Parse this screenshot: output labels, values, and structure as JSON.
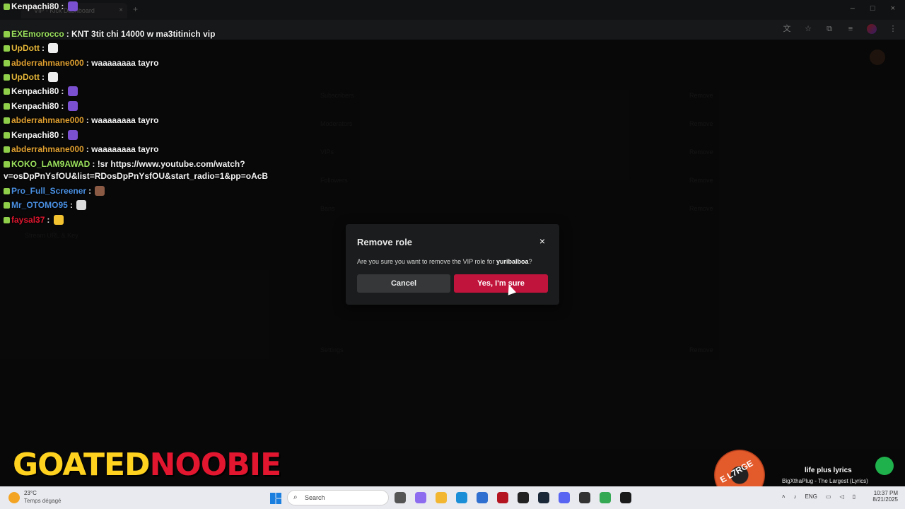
{
  "browser": {
    "tab_title": "VIP - Kick Dashboard",
    "tab_close": "×",
    "new_tab": "+",
    "controls": [
      "–",
      "□",
      "×"
    ]
  },
  "dashboard": {
    "items": [
      "Subscribers",
      "Moderators",
      "VIPs",
      "Followers",
      "Bans",
      "Settings"
    ],
    "side_item": "Stream URL & Key",
    "btn_label": "Remove"
  },
  "chat": [
    {
      "user": "Kenpachi80",
      "msg": "",
      "user_color": "#f2f2f2",
      "emote": "#7a4fd0"
    },
    {
      "user": "EXEmorocco",
      "msg": "KNT 3tit chi 14000 w ma3titinich vip",
      "user_color": "#9be15d",
      "emote": ""
    },
    {
      "user": "UpDott",
      "msg": "",
      "user_color": "#e8b93a",
      "emote": "#eeeeee"
    },
    {
      "user": "abderrahmane000",
      "msg": "waaaaaaaa tayro",
      "user_color": "#e0a030",
      "emote": ""
    },
    {
      "user": "UpDott",
      "msg": "",
      "user_color": "#e8b93a",
      "emote": "#eeeeee"
    },
    {
      "user": "Kenpachi80",
      "msg": "",
      "user_color": "#f2f2f2",
      "emote": "#7a4fd0"
    },
    {
      "user": "Kenpachi80",
      "msg": "",
      "user_color": "#f2f2f2",
      "emote": "#7a4fd0"
    },
    {
      "user": "abderrahmane000",
      "msg": "waaaaaaaa tayro",
      "user_color": "#e0a030",
      "emote": ""
    },
    {
      "user": "Kenpachi80",
      "msg": "",
      "user_color": "#f2f2f2",
      "emote": "#7a4fd0"
    },
    {
      "user": "abderrahmane000",
      "msg": "waaaaaaaa tayro",
      "user_color": "#e0a030",
      "emote": ""
    },
    {
      "user": "KOKO_LAM9AWAD",
      "msg": "!sr https://www.youtube.com/watch?",
      "user_color": "#9be15d",
      "emote": ""
    },
    {
      "user": "",
      "msg": "v=osDpPnYsfOU&list=RDosDpPnYsfOU&start_radio=1&pp=oAcB",
      "user_color": "#f2f2f2",
      "emote": ""
    },
    {
      "user": "Pro_Full_Screener",
      "msg": "",
      "user_color": "#4a90e2",
      "emote": "#8a5a44"
    },
    {
      "user": "Mr_OTOMO95",
      "msg": "",
      "user_color": "#4a90e2",
      "emote": "#dddddd"
    },
    {
      "user": "faysal37",
      "msg": "",
      "user_color": "#e2162f",
      "emote": "#f2c230"
    }
  ],
  "modal": {
    "title": "Remove role",
    "close": "×",
    "text_prefix": "Are you sure you want to remove the VIP role for",
    "username": "yuribalboa",
    "text_suffix": "?",
    "cancel": "Cancel",
    "confirm": "Yes, I'm sure"
  },
  "logo": {
    "part1": "GOATED",
    "part2": "NOOBIE"
  },
  "music": {
    "disc_text": "E L7RGE",
    "song": "life plus lyrics",
    "artist": "BigXthaPlug - The Largest (Lyrics)"
  },
  "taskbar": {
    "temp": "23°C",
    "weather": "Temps dégagé",
    "search": "Search",
    "search_icon": "⌕",
    "lang": "ENG",
    "time": "10:37 PM",
    "date": "8/21/2025"
  },
  "colors": {
    "confirm": "#c1143c",
    "accent_green": "#9be15d"
  }
}
